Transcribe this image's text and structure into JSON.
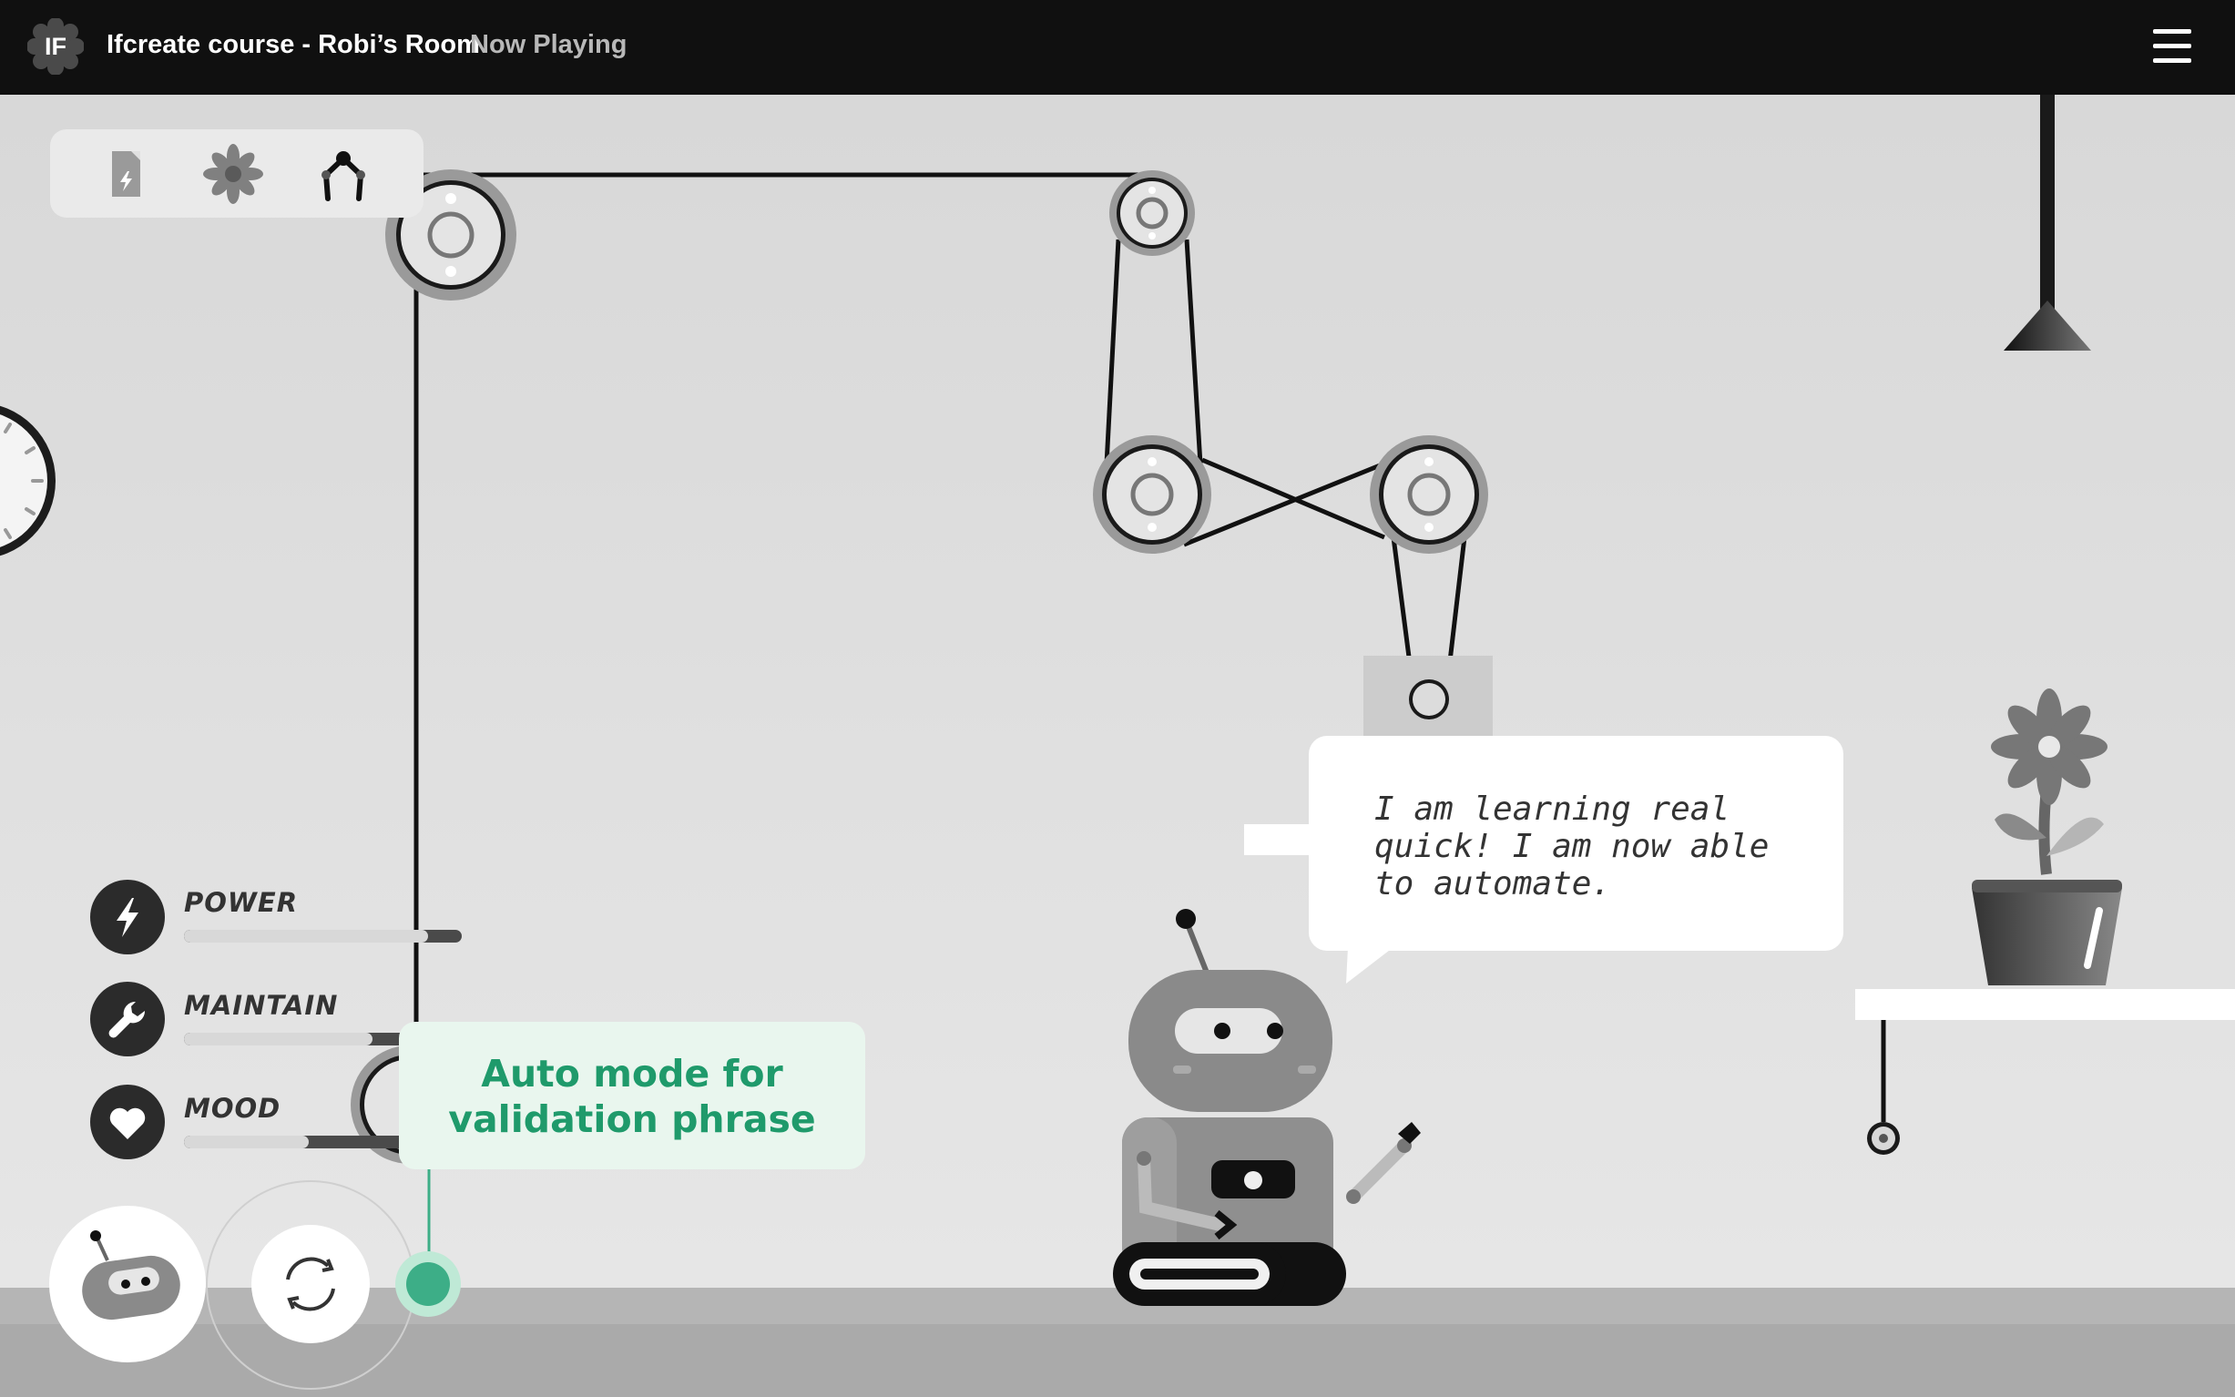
{
  "header": {
    "logo_text": "IF",
    "title": "Ifcreate course - Robi’s Room",
    "status": "Now Playing",
    "menu_icon": "hamburger-menu-icon"
  },
  "toolbar": {
    "tools": [
      {
        "name": "battery-icon"
      },
      {
        "name": "flower-icon"
      },
      {
        "name": "claw-icon"
      }
    ]
  },
  "stats": {
    "power": {
      "label": "POWER",
      "level": 0.88,
      "icon": "lightning-icon"
    },
    "maintain": {
      "label": "MAINTAIN",
      "level": 0.68,
      "icon": "wrench-icon"
    },
    "mood": {
      "label": "MOOD",
      "level": 0.45,
      "icon": "heart-icon"
    }
  },
  "speech": {
    "text": "I am learning real quick! I am now able to automate."
  },
  "tooltip": {
    "line1": "Auto mode for",
    "line2": "validation phrase"
  },
  "controls": {
    "robot_button_icon": "robot-face-icon",
    "cycle_button_icon": "refresh-cycle-icon",
    "auto_indicator": "auto-mode-dot"
  },
  "colors": {
    "topbar": "#101010",
    "accent_green": "#1f9a6b",
    "tooltip_bg": "#e9f6ee",
    "floor": "#aaaaaa"
  }
}
